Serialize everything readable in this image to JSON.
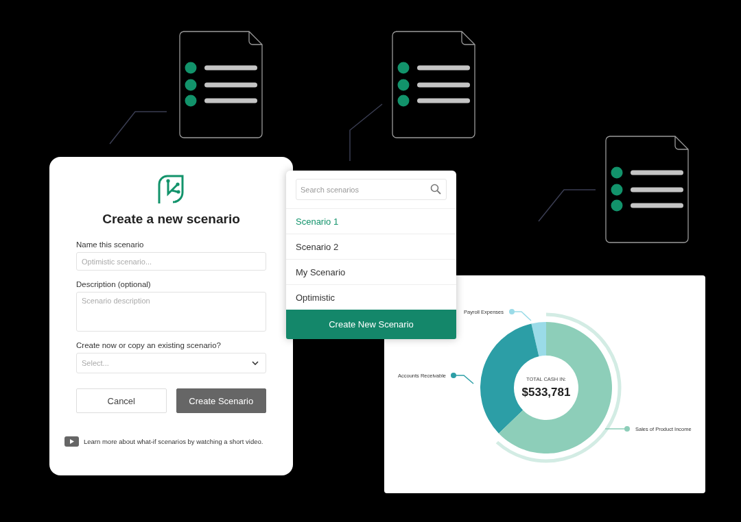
{
  "documents": [
    {
      "kind": "document"
    },
    {
      "kind": "document"
    },
    {
      "kind": "document"
    }
  ],
  "dialog": {
    "title": "Create a new scenario",
    "fields": [
      {
        "kind": "input",
        "label": "Name this scenario",
        "placeholder": "Optimistic scenario..."
      },
      {
        "kind": "textarea",
        "label": "Description (optional)",
        "placeholder": "Scenario description"
      },
      {
        "kind": "select",
        "label": "Create now or copy an existing scenario?",
        "placeholder": "Select..."
      }
    ],
    "buttons": [
      {
        "kind": "secondary",
        "label": "Cancel"
      },
      {
        "kind": "primary",
        "label": "Create Scenario"
      }
    ],
    "video_note": "Learn more about what-if scenarios by watching a short video."
  },
  "scenario_menu": {
    "search": {
      "placeholder": "Search scenarios"
    },
    "items": [
      {
        "label": "Scenario 1",
        "selected": true
      },
      {
        "label": "Scenario 2",
        "selected": false
      },
      {
        "label": "My Scenario",
        "selected": false
      },
      {
        "label": "Optimistic",
        "selected": false
      }
    ],
    "create_button": "Create New Scenario"
  },
  "cash_chart": {
    "center_label": "TOTAL CASH IN:",
    "total": "$533,781",
    "segments": [
      {
        "label": "Payroll Expenses",
        "color": "#9adbe8"
      },
      {
        "label": "Accounts Receivable",
        "color": "#2c9ea6"
      },
      {
        "label": "Sales of Product Income",
        "color": "#8dceb9"
      }
    ]
  }
}
